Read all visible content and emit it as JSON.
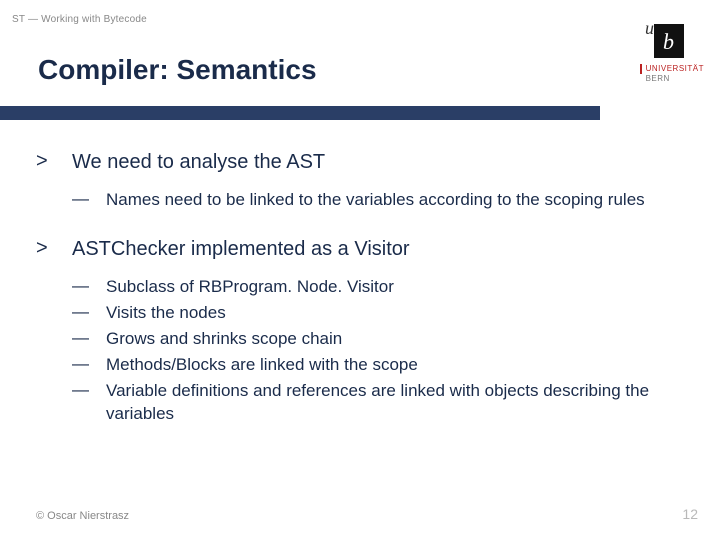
{
  "header": {
    "eyebrow": "ST — Working with Bytecode",
    "title": "Compiler: Semantics"
  },
  "logo": {
    "u": "u",
    "b_svg_label": "b",
    "line1": "UNIVERSITÄT",
    "line2": "BERN"
  },
  "content": {
    "markers": {
      "l1": ">",
      "l2": "—"
    },
    "point1": {
      "text": "We need to analyse the AST",
      "subs": [
        "Names need to be linked to the variables according to the scoping rules"
      ]
    },
    "point2": {
      "text": "ASTChecker implemented as a Visitor",
      "subs": [
        "Subclass of RBProgram. Node. Visitor",
        "Visits the nodes",
        "Grows and shrinks scope chain",
        "Methods/Blocks are linked with the scope",
        "Variable definitions and references are linked with objects describing the variables"
      ]
    }
  },
  "footer": {
    "left": "© Oscar Nierstrasz",
    "right": "12"
  }
}
